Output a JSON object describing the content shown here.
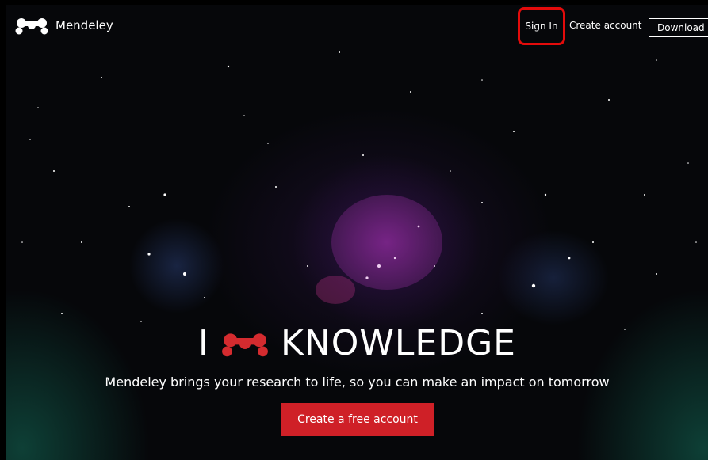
{
  "header": {
    "brand_name": "Mendeley",
    "brand_icon": "mendeley-logo-icon",
    "sign_in_label": "Sign In",
    "create_account_label": "Create account",
    "download_label": "Download"
  },
  "hero": {
    "title_prefix": "I",
    "title_suffix": "KNOWLEDGE",
    "heart_icon": "mendeley-logo-red-icon",
    "subtitle": "Mendeley brings your research to life, so you can make an impact on tomorrow",
    "cta_label": "Create a free account"
  },
  "colors": {
    "highlight_border": "#e30b0b",
    "cta_background": "#cf2027",
    "logo_red": "#d42b2f"
  }
}
